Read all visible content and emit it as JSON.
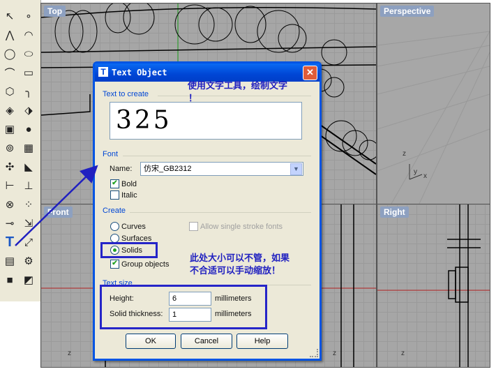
{
  "toolbar": {
    "icons": [
      "select-arrow-icon",
      "point-icon",
      "polyline-icon",
      "curve-icon",
      "circle-icon",
      "ellipse-icon",
      "arc-icon",
      "rectangle-icon",
      "polygon-icon",
      "fillet-icon",
      "surface-icon",
      "loft-icon",
      "box-icon",
      "sphere-icon",
      "cylinder-icon",
      "mesh-icon",
      "transform-icon",
      "boolean-icon",
      "dimension-icon",
      "align-icon",
      "group-icon",
      "array-icon",
      "curve-tools-icon",
      "snap-icon",
      "text-icon",
      "scale-icon",
      "block-icon",
      "render-icon",
      "solid-box-icon",
      "hidden-icon"
    ]
  },
  "viewports": {
    "top": "Top",
    "perspective": "Perspective",
    "front": "Front",
    "right": "Right"
  },
  "dialog": {
    "title": "Text Object",
    "close": "✕",
    "text_to_create_label": "Text to create",
    "text_value": "325",
    "font_label": "Font",
    "name_label": "Name:",
    "font_name": "仿宋_GB2312",
    "bold_label": "Bold",
    "bold_checked": true,
    "italic_label": "Italic",
    "italic_checked": false,
    "create_label": "Create",
    "curves_label": "Curves",
    "surfaces_label": "Surfaces",
    "solids_label": "Solids",
    "selected_create": "Solids",
    "single_stroke_label": "Allow single stroke fonts",
    "group_objects_label": "Group objects",
    "group_objects_checked": true,
    "text_size_label": "Text size",
    "height_label": "Height:",
    "height_value": "6",
    "height_unit": "millimeters",
    "thickness_label": "Solid thickness:",
    "thickness_value": "1",
    "thickness_unit": "millimeters",
    "ok": "OK",
    "cancel": "Cancel",
    "help": "Help"
  },
  "annotations": {
    "note1": "使用文字工具，绘制文字",
    "note1_tail": "！",
    "note2_line1": "此处大小可以不管，如果",
    "note2_line2": "不合适可以手动缩放！",
    "color": "#2020c0"
  }
}
